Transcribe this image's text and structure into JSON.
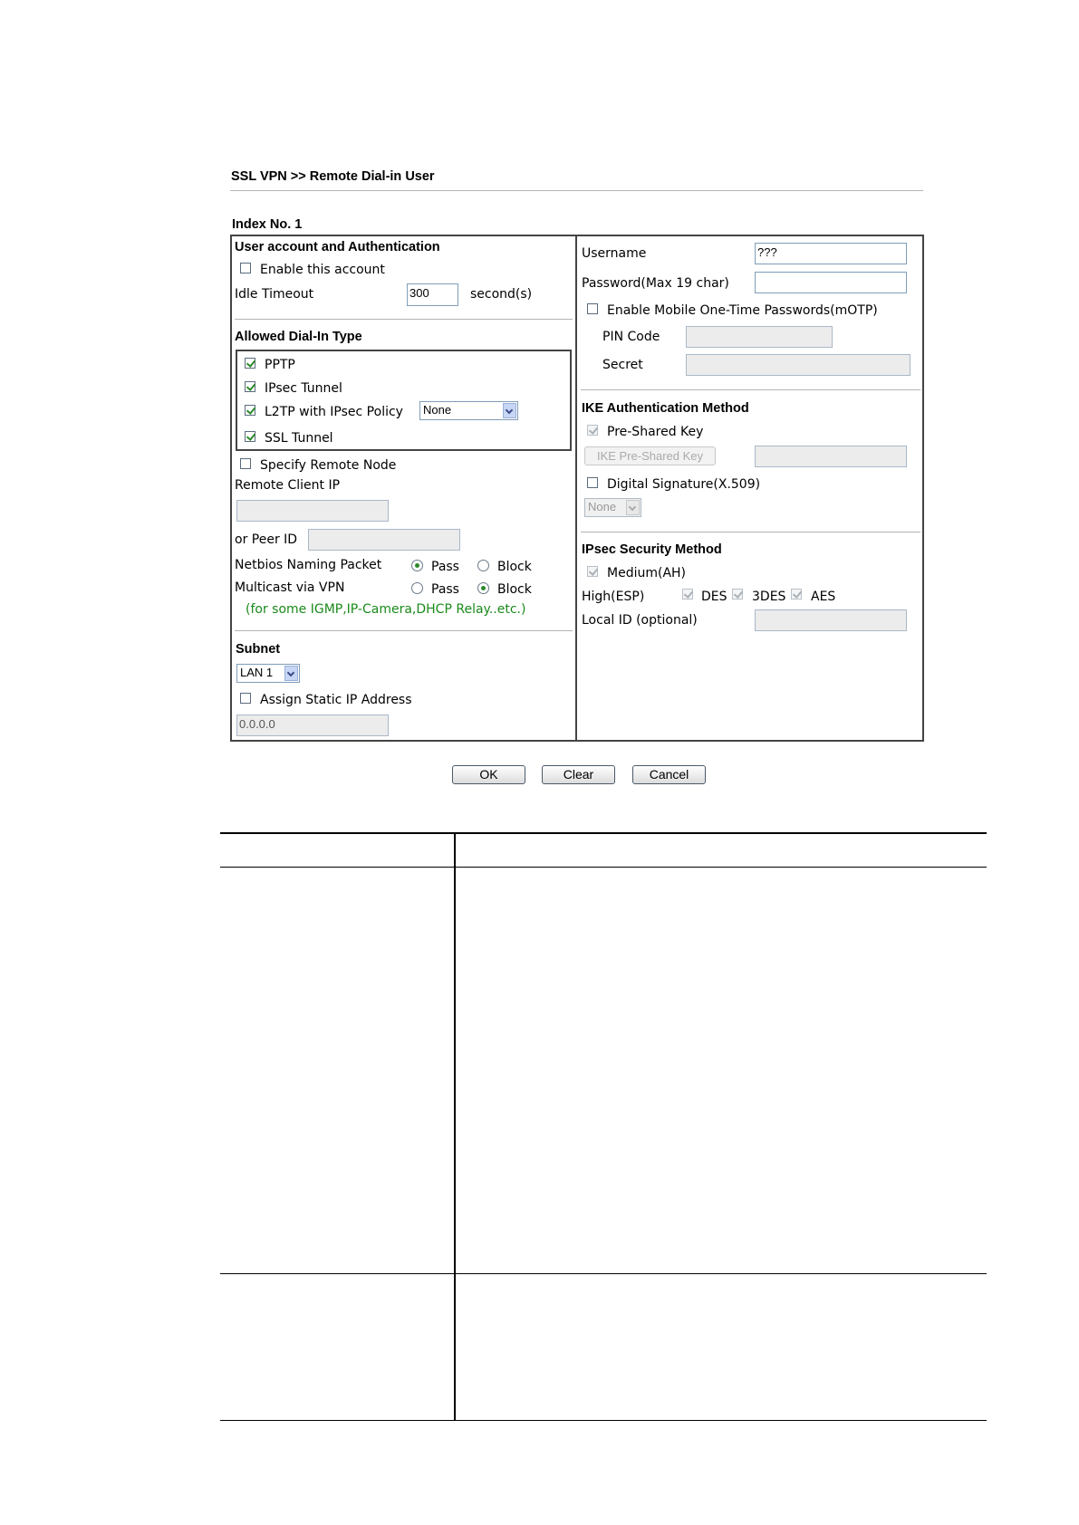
{
  "breadcrumb": "SSL VPN >> Remote Dial-in User",
  "index_label": "Index No. 1",
  "left": {
    "user_auth_title": "User account and Authentication",
    "enable_account": {
      "label": "Enable this account",
      "checked": false
    },
    "idle_timeout": {
      "label": "Idle Timeout",
      "value": "300",
      "unit": "second(s)"
    },
    "dialin_title": "Allowed Dial-In Type",
    "dialin": {
      "pptp": {
        "label": "PPTP",
        "checked": true
      },
      "ipsec": {
        "label": "IPsec Tunnel",
        "checked": true
      },
      "l2tp": {
        "label": "L2TP with IPsec Policy",
        "checked": true,
        "policy": "None"
      },
      "ssl": {
        "label": "SSL Tunnel",
        "checked": true
      }
    },
    "specify_remote": {
      "label": "Specify Remote Node",
      "checked": false
    },
    "remote_client_ip": {
      "label": "Remote Client IP",
      "value": ""
    },
    "peer_id": {
      "label": "or Peer ID",
      "value": ""
    },
    "netbios": {
      "label": "Netbios Naming Packet",
      "pass": "Pass",
      "block": "Block",
      "selected": "Pass"
    },
    "multicast": {
      "label": "Multicast via VPN",
      "pass": "Pass",
      "block": "Block",
      "selected": "Block"
    },
    "multicast_note": "(for some IGMP,IP-Camera,DHCP Relay..etc.)",
    "subnet_title": "Subnet",
    "subnet_value": "LAN 1",
    "assign_static": {
      "label": "Assign Static IP Address",
      "checked": false,
      "value": "0.0.0.0"
    }
  },
  "right": {
    "username": {
      "label": "Username",
      "value": "???"
    },
    "password": {
      "label": "Password(Max 19 char)",
      "value": ""
    },
    "motp": {
      "label": "Enable Mobile One-Time Passwords(mOTP)",
      "checked": false
    },
    "pin_code": {
      "label": "PIN Code",
      "value": ""
    },
    "secret": {
      "label": "Secret",
      "value": ""
    },
    "ike_title": "IKE Authentication Method",
    "pre_shared": {
      "label": "Pre-Shared Key",
      "checked": true
    },
    "ike_psk_button": "IKE Pre-Shared Key",
    "ike_psk_value": "",
    "digital_sig": {
      "label": "Digital Signature(X.509)",
      "checked": false,
      "value": "None"
    },
    "ipsec_title": "IPsec Security Method",
    "medium": {
      "label": "Medium(AH)",
      "checked": true
    },
    "high_label": "High(ESP)",
    "des": {
      "label": "DES",
      "checked": true
    },
    "tdes": {
      "label": "3DES",
      "checked": true
    },
    "aes": {
      "label": "AES",
      "checked": true
    },
    "local_id": {
      "label": "Local ID (optional)",
      "value": ""
    }
  },
  "buttons": {
    "ok": "OK",
    "clear": "Clear",
    "cancel": "Cancel"
  }
}
